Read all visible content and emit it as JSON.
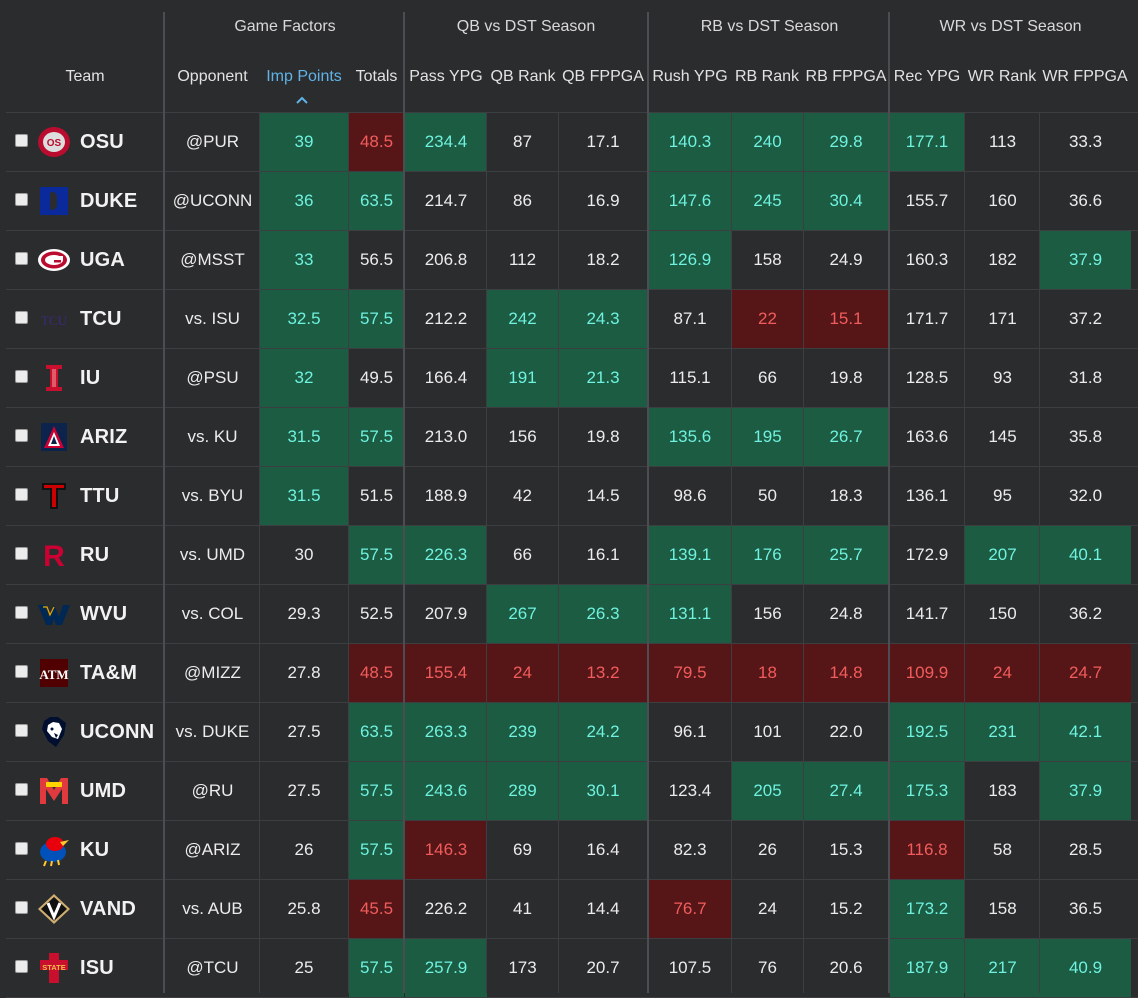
{
  "groups": {
    "game_factors": "Game Factors",
    "qb": "QB vs DST Season",
    "rb": "RB vs DST Season",
    "wr": "WR vs DST Season"
  },
  "columns": {
    "team": "Team",
    "opponent": "Opponent",
    "imp_points": "Imp Points",
    "totals": "Totals",
    "pass_ypg": "Pass YPG",
    "qb_rank": "QB Rank",
    "qb_fppga": "QB FPPGA",
    "rush_ypg": "Rush YPG",
    "rb_rank": "RB Rank",
    "rb_fppga": "RB FPPGA",
    "rec_ypg": "Rec YPG",
    "wr_rank": "WR Rank",
    "wr_fppga": "WR FPPGA"
  },
  "sort": {
    "column": "imp_points",
    "icon": "chevron-up-icon"
  },
  "rows": [
    {
      "team": "OSU",
      "logo": "osu-logo-icon",
      "opp": "@PUR",
      "imp": "39",
      "tot": "48.5",
      "pass": "234.4",
      "qbr": "87",
      "qbf": "17.1",
      "rush": "140.3",
      "rbr": "240",
      "rbf": "29.8",
      "rec": "177.1",
      "wrr": "113",
      "wrf": "33.3"
    },
    {
      "team": "DUKE",
      "logo": "duke-logo-icon",
      "opp": "@UCONN",
      "imp": "36",
      "tot": "63.5",
      "pass": "214.7",
      "qbr": "86",
      "qbf": "16.9",
      "rush": "147.6",
      "rbr": "245",
      "rbf": "30.4",
      "rec": "155.7",
      "wrr": "160",
      "wrf": "36.6"
    },
    {
      "team": "UGA",
      "logo": "uga-logo-icon",
      "opp": "@MSST",
      "imp": "33",
      "tot": "56.5",
      "pass": "206.8",
      "qbr": "112",
      "qbf": "18.2",
      "rush": "126.9",
      "rbr": "158",
      "rbf": "24.9",
      "rec": "160.3",
      "wrr": "182",
      "wrf": "37.9"
    },
    {
      "team": "TCU",
      "logo": "tcu-logo-icon",
      "opp": "vs. ISU",
      "imp": "32.5",
      "tot": "57.5",
      "pass": "212.2",
      "qbr": "242",
      "qbf": "24.3",
      "rush": "87.1",
      "rbr": "22",
      "rbf": "15.1",
      "rec": "171.7",
      "wrr": "171",
      "wrf": "37.2"
    },
    {
      "team": "IU",
      "logo": "iu-logo-icon",
      "opp": "@PSU",
      "imp": "32",
      "tot": "49.5",
      "pass": "166.4",
      "qbr": "191",
      "qbf": "21.3",
      "rush": "115.1",
      "rbr": "66",
      "rbf": "19.8",
      "rec": "128.5",
      "wrr": "93",
      "wrf": "31.8"
    },
    {
      "team": "ARIZ",
      "logo": "ariz-logo-icon",
      "opp": "vs. KU",
      "imp": "31.5",
      "tot": "57.5",
      "pass": "213.0",
      "qbr": "156",
      "qbf": "19.8",
      "rush": "135.6",
      "rbr": "195",
      "rbf": "26.7",
      "rec": "163.6",
      "wrr": "145",
      "wrf": "35.8"
    },
    {
      "team": "TTU",
      "logo": "ttu-logo-icon",
      "opp": "vs. BYU",
      "imp": "31.5",
      "tot": "51.5",
      "pass": "188.9",
      "qbr": "42",
      "qbf": "14.5",
      "rush": "98.6",
      "rbr": "50",
      "rbf": "18.3",
      "rec": "136.1",
      "wrr": "95",
      "wrf": "32.0"
    },
    {
      "team": "RU",
      "logo": "ru-logo-icon",
      "opp": "vs. UMD",
      "imp": "30",
      "tot": "57.5",
      "pass": "226.3",
      "qbr": "66",
      "qbf": "16.1",
      "rush": "139.1",
      "rbr": "176",
      "rbf": "25.7",
      "rec": "172.9",
      "wrr": "207",
      "wrf": "40.1"
    },
    {
      "team": "WVU",
      "logo": "wvu-logo-icon",
      "opp": "vs. COL",
      "imp": "29.3",
      "tot": "52.5",
      "pass": "207.9",
      "qbr": "267",
      "qbf": "26.3",
      "rush": "131.1",
      "rbr": "156",
      "rbf": "24.8",
      "rec": "141.7",
      "wrr": "150",
      "wrf": "36.2"
    },
    {
      "team": "TA&M",
      "logo": "tamu-logo-icon",
      "opp": "@MIZZ",
      "imp": "27.8",
      "tot": "48.5",
      "pass": "155.4",
      "qbr": "24",
      "qbf": "13.2",
      "rush": "79.5",
      "rbr": "18",
      "rbf": "14.8",
      "rec": "109.9",
      "wrr": "24",
      "wrf": "24.7"
    },
    {
      "team": "UCONN",
      "logo": "uconn-logo-icon",
      "opp": "vs. DUKE",
      "imp": "27.5",
      "tot": "63.5",
      "pass": "263.3",
      "qbr": "239",
      "qbf": "24.2",
      "rush": "96.1",
      "rbr": "101",
      "rbf": "22.0",
      "rec": "192.5",
      "wrr": "231",
      "wrf": "42.1"
    },
    {
      "team": "UMD",
      "logo": "umd-logo-icon",
      "opp": "@RU",
      "imp": "27.5",
      "tot": "57.5",
      "pass": "243.6",
      "qbr": "289",
      "qbf": "30.1",
      "rush": "123.4",
      "rbr": "205",
      "rbf": "27.4",
      "rec": "175.3",
      "wrr": "183",
      "wrf": "37.9"
    },
    {
      "team": "KU",
      "logo": "ku-logo-icon",
      "opp": "@ARIZ",
      "imp": "26",
      "tot": "57.5",
      "pass": "146.3",
      "qbr": "69",
      "qbf": "16.4",
      "rush": "82.3",
      "rbr": "26",
      "rbf": "15.3",
      "rec": "116.8",
      "wrr": "58",
      "wrf": "28.5"
    },
    {
      "team": "VAND",
      "logo": "vand-logo-icon",
      "opp": "vs. AUB",
      "imp": "25.8",
      "tot": "45.5",
      "pass": "226.2",
      "qbr": "41",
      "qbf": "14.4",
      "rush": "76.7",
      "rbr": "24",
      "rbf": "15.2",
      "rec": "173.2",
      "wrr": "158",
      "wrf": "36.5"
    },
    {
      "team": "ISU",
      "logo": "isu-logo-icon",
      "opp": "@TCU",
      "imp": "25",
      "tot": "57.5",
      "pass": "257.9",
      "qbr": "173",
      "qbf": "20.7",
      "rush": "107.5",
      "rbr": "76",
      "rbf": "20.6",
      "rec": "187.9",
      "wrr": "217",
      "wrf": "40.9"
    }
  ],
  "highlights": [
    {
      "imp": "g",
      "tot": "r",
      "pass": "g",
      "rush": "g",
      "rbr": "g",
      "rbf": "g",
      "rec": "g"
    },
    {
      "imp": "g",
      "tot": "g",
      "rush": "g",
      "rbr": "g",
      "rbf": "g"
    },
    {
      "imp": "g",
      "rush": "g",
      "wrf": "g"
    },
    {
      "imp": "g",
      "tot": "g",
      "qbr": "g",
      "qbf": "g",
      "rbr": "r",
      "rbf": "r"
    },
    {
      "imp": "g",
      "qbr": "g",
      "qbf": "g"
    },
    {
      "imp": "g",
      "tot": "g",
      "rush": "g",
      "rbr": "g",
      "rbf": "g"
    },
    {
      "imp": "g"
    },
    {
      "tot": "g",
      "pass": "g",
      "rush": "g",
      "rbr": "g",
      "rbf": "g",
      "wrr": "g",
      "wrf": "g"
    },
    {
      "qbr": "g",
      "qbf": "g",
      "rush": "g"
    },
    {
      "tot": "r",
      "pass": "r",
      "qbr": "r",
      "qbf": "r",
      "rush": "r",
      "rbr": "r",
      "rbf": "r",
      "rec": "r",
      "wrr": "r",
      "wrf": "r"
    },
    {
      "tot": "g",
      "pass": "g",
      "qbr": "g",
      "qbf": "g",
      "rec": "g",
      "wrr": "g",
      "wrf": "g"
    },
    {
      "tot": "g",
      "pass": "g",
      "qbr": "g",
      "qbf": "g",
      "rbr": "g",
      "rbf": "g",
      "rec": "g",
      "wrf": "g"
    },
    {
      "tot": "g",
      "pass": "r",
      "rec": "r"
    },
    {
      "tot": "r",
      "rush": "r",
      "rec": "g"
    },
    {
      "tot": "g",
      "pass": "g",
      "rec": "g",
      "wrr": "g",
      "wrf": "g"
    }
  ],
  "colors": {
    "positive_bg": "#1b5c43",
    "positive_text": "#6ff2df",
    "negative_bg": "#561617",
    "negative_text": "#f25c5c",
    "sorted_header": "#5fb3e8"
  }
}
